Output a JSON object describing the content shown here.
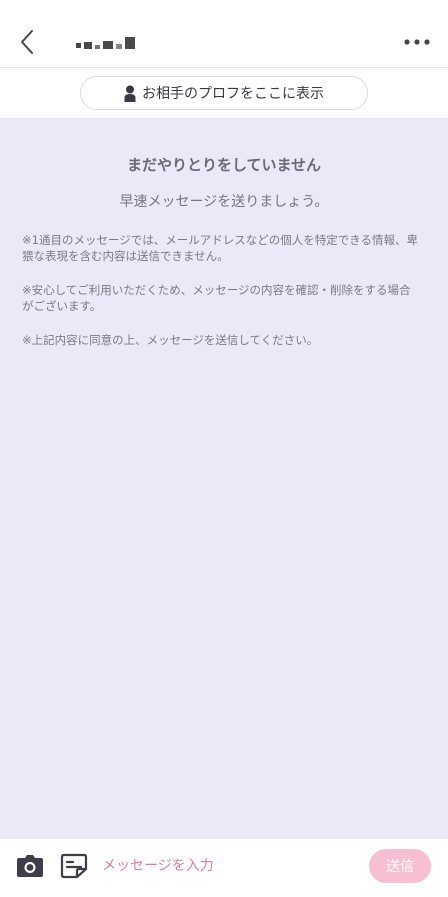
{
  "header": {
    "back_icon": "chevron-left-icon",
    "more_icon": "more-horizontal-icon"
  },
  "profile_button": {
    "icon": "person-icon",
    "label": "お相手のプロフをここに表示"
  },
  "chat": {
    "empty_title": "まだやりとりをしていません",
    "empty_subtitle": "早速メッセージを送りましょう。",
    "notes": [
      "※1通目のメッセージでは、メールアドレスなどの個人を特定できる情報、卑猥な表現を含む内容は送信できません。",
      "※安心してご利用いただくため、メッセージの内容を確認・削除をする場合がございます。",
      "※上記内容に同意の上、メッセージを送信してください。"
    ]
  },
  "footer": {
    "camera_icon": "camera-icon",
    "stamp_icon": "sticker-icon",
    "input_placeholder": "メッセージを入力",
    "input_value": "",
    "send_label": "送信"
  },
  "colors": {
    "chat_background": "#ebe8f8",
    "accent_pink": "#e37c9e",
    "send_disabled": "#f6bfd2"
  }
}
